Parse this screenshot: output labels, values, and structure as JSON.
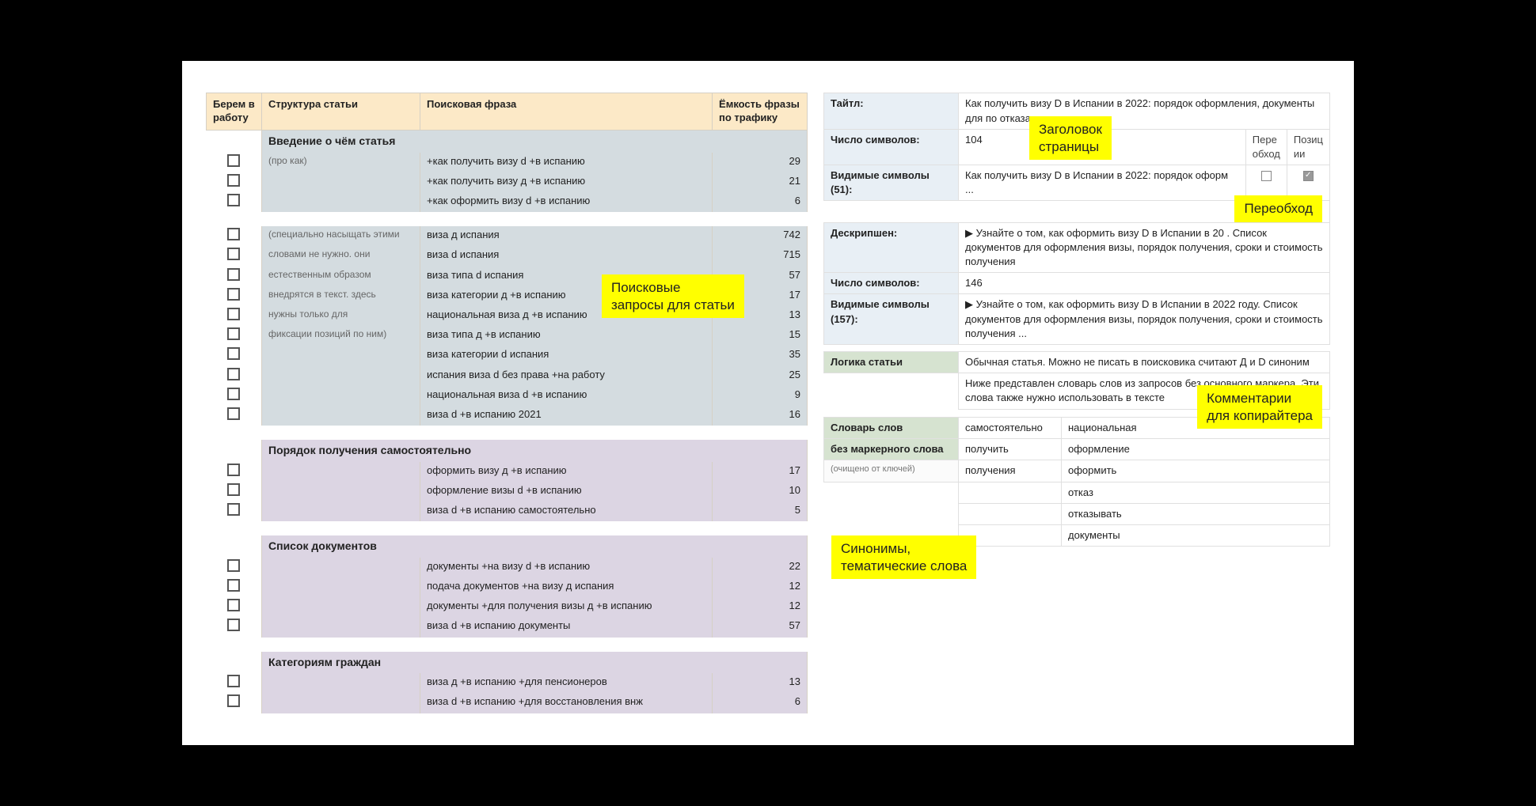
{
  "left": {
    "headers": {
      "take": "Берем в работу",
      "struct": "Структура статьи",
      "phrase": "Поисковая фраза",
      "traffic": "Ёмкость фразы по трафику"
    },
    "sections": [
      {
        "title": "Введение о чём статья",
        "tone": "blue",
        "struct_notes": [
          "(про как)",
          "",
          ""
        ],
        "rows": [
          {
            "phrase": "+как получить визу d +в испанию",
            "traffic": 29
          },
          {
            "phrase": "+как получить визу д +в испанию",
            "traffic": 21
          },
          {
            "phrase": "+как оформить визу d +в испанию",
            "traffic": 6
          }
        ]
      },
      {
        "tone": "blue",
        "struct_notes": [
          "(специально насыщать этими",
          "словами не нужно. они",
          "естественным образом",
          "внедрятся в текст. здесь",
          "нужны только для",
          "фиксации позиций по ним)",
          "",
          "",
          "",
          ""
        ],
        "rows": [
          {
            "phrase": "виза д испания",
            "traffic": 742
          },
          {
            "phrase": "виза d испания",
            "traffic": 715
          },
          {
            "phrase": "виза типа d испания",
            "traffic": 57
          },
          {
            "phrase": "виза категории д +в испанию",
            "traffic": 17
          },
          {
            "phrase": "национальная виза д +в испанию",
            "traffic": 13
          },
          {
            "phrase": "виза типа д +в испанию",
            "traffic": 15
          },
          {
            "phrase": "виза категории d испания",
            "traffic": 35
          },
          {
            "phrase": "испания виза d без права +на работу",
            "traffic": 25
          },
          {
            "phrase": "национальная виза d +в испанию",
            "traffic": 9
          },
          {
            "phrase": "виза d +в испанию 2021",
            "traffic": 16
          }
        ]
      },
      {
        "title": "Порядок получения самостоятельно",
        "tone": "purple",
        "rows": [
          {
            "phrase": "оформить визу д +в испанию",
            "traffic": 17
          },
          {
            "phrase": "оформление визы d +в испанию",
            "traffic": 10
          },
          {
            "phrase": "виза d +в испанию самостоятельно",
            "traffic": 5
          }
        ]
      },
      {
        "title": "Список документов",
        "tone": "purple",
        "rows": [
          {
            "phrase": "документы +на визу d +в испанию",
            "traffic": 22
          },
          {
            "phrase": "подача документов +на визу д испания",
            "traffic": 12
          },
          {
            "phrase": "документы +для получения визы д +в испанию",
            "traffic": 12
          },
          {
            "phrase": "виза d +в испанию документы",
            "traffic": 57
          }
        ]
      },
      {
        "title": "Категориям граждан",
        "tone": "purple",
        "rows": [
          {
            "phrase": "виза д +в испанию +для пенсионеров",
            "traffic": 13
          },
          {
            "phrase": "виза d +в испанию +для восстановления внж",
            "traffic": 6
          }
        ]
      }
    ]
  },
  "right": {
    "title_label": "Тайтл:",
    "title_value": "Как получить визу D в Испании в 2022: порядок оформления, документы для по                                                                     отказа",
    "chars_label": "Число символов:",
    "chars_value": "104",
    "visible_label": "Видимые символы (51):",
    "visible_value": "Как получить визу D в Испании в 2022: порядок оформ ...",
    "pere_label": "Пере обход",
    "pos_label": "Позиц ии",
    "desc_label": "Дескрипшен:",
    "desc_value": "▶  Узнайте о том, как оформить визу D в Испании в 20                  . Список документов для оформления визы, порядок получения, сроки и стоимость получения",
    "desc_chars_label": "Число символов:",
    "desc_chars_value": "146",
    "desc_visible_label": "Видимые символы (157):",
    "desc_visible_value": "▶  Узнайте о том, как оформить визу D в Испании в 2022 году. Список документов для оформления визы, порядок получения, сроки и стоимость получения  ...",
    "logic_label": "Логика статьи",
    "logic_value": "Обычная статья. Можно не писать в                                              поисковика считают Д и D синоним",
    "dict_intro": "Ниже представлен словарь слов из запросов без основного маркера. Эти слова также нужно использовать в тексте",
    "dict_label": "Словарь слов без маркерного слова",
    "dict_note": "(очищено от ключей)",
    "dict_col1": [
      "самостоятельно",
      "получить",
      "получения",
      ""
    ],
    "dict_col2": [
      "национальная",
      "оформление",
      "оформить",
      "отказ",
      "отказывать",
      "документы"
    ]
  },
  "callouts": {
    "c1": "Заголовок\nстраницы",
    "c2": "Переобход",
    "c3": "Поисковые\nзапросы для статьи",
    "c4": "Комментарии\nдля копирайтера",
    "c5": "Синонимы,\nтематические слова"
  }
}
